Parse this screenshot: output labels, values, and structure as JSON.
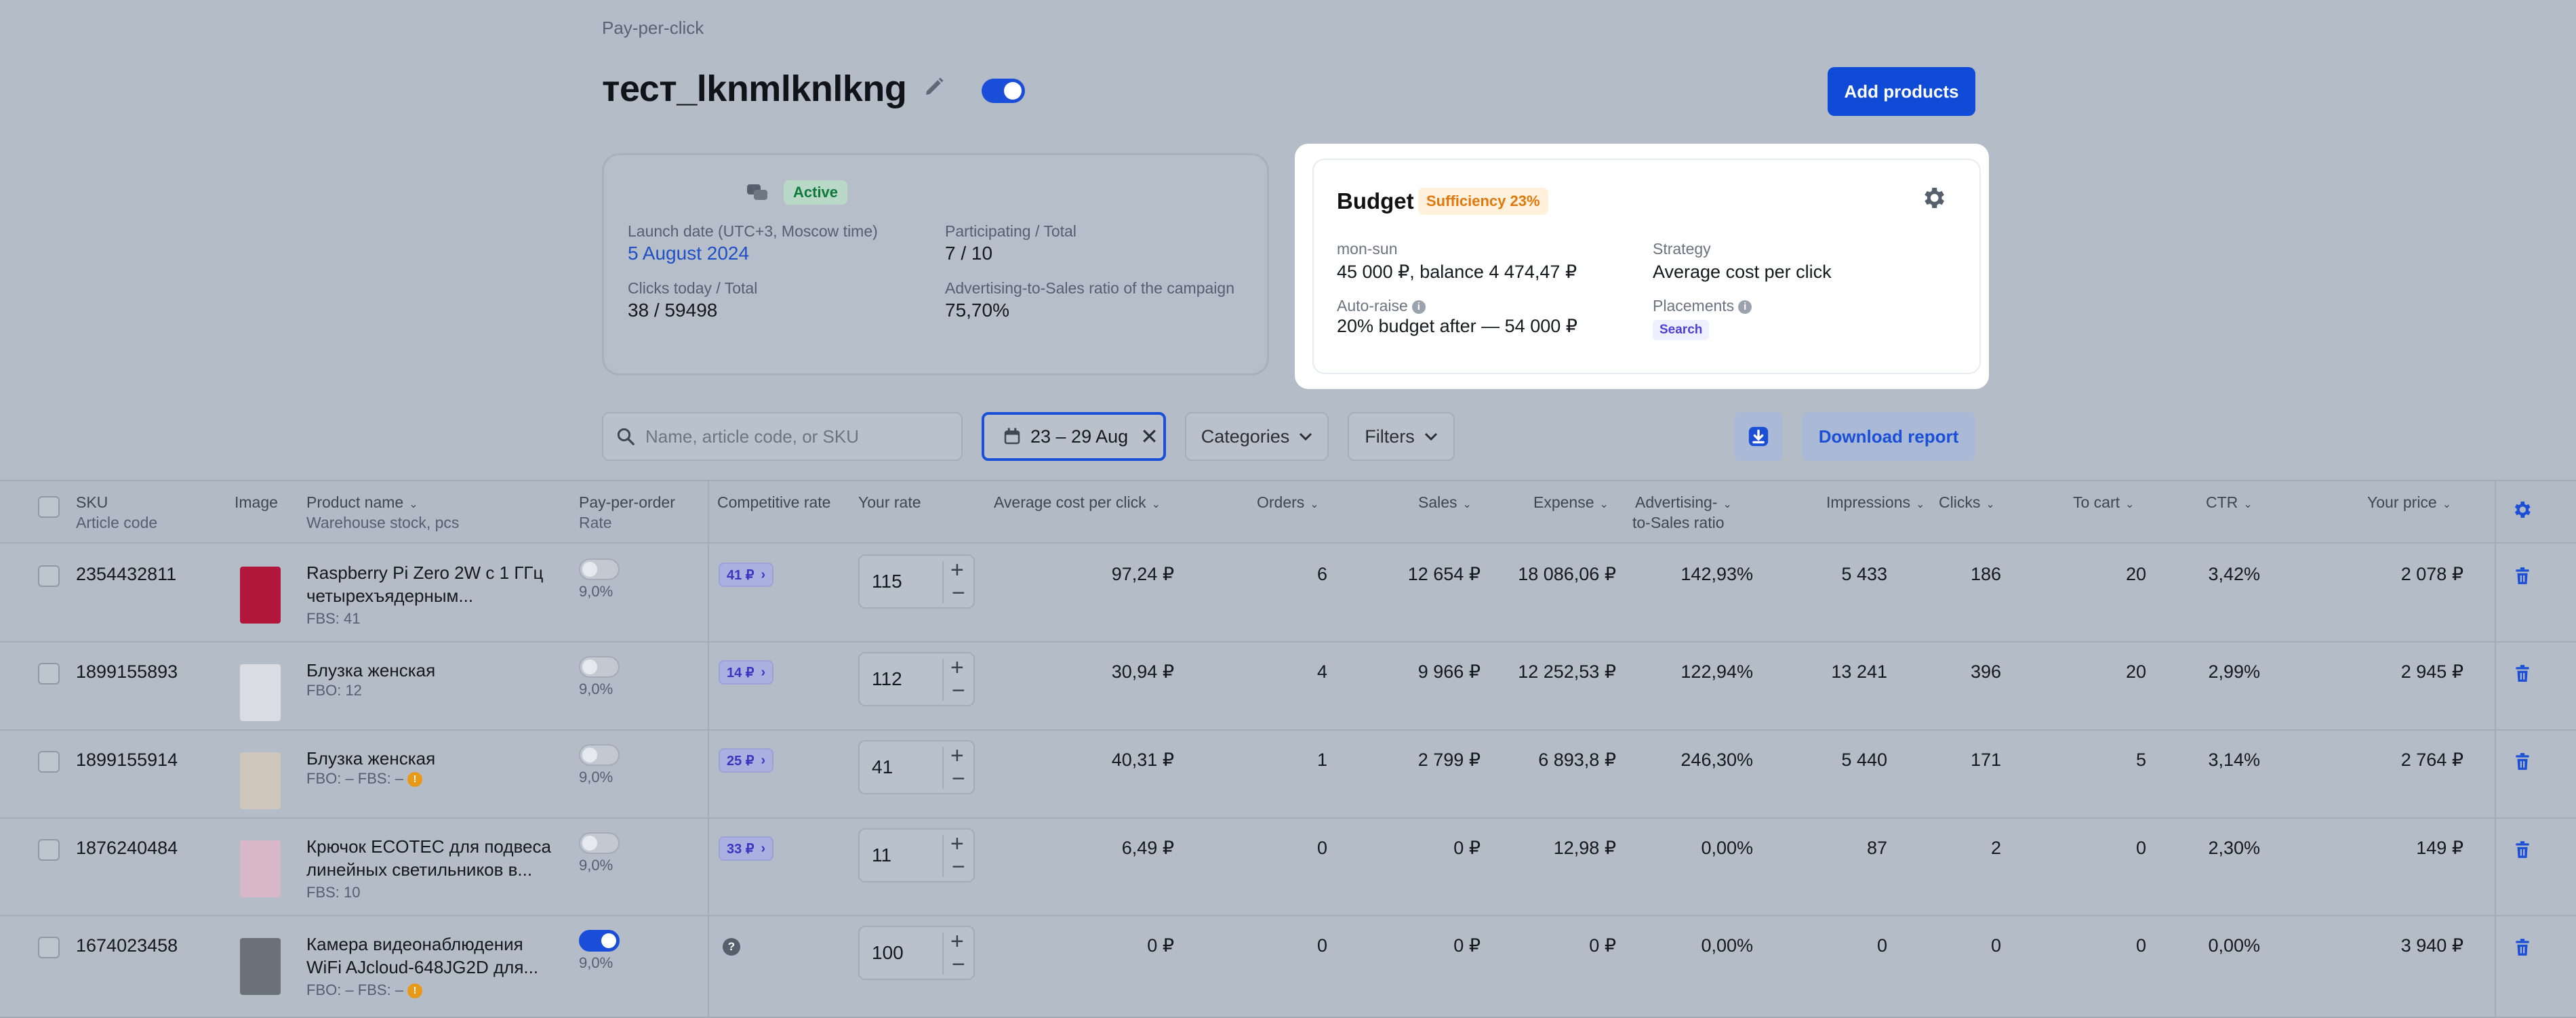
{
  "header": {
    "breadcrumb": "Pay-per-click",
    "title": "тест_lknmlknlkng",
    "add_products_label": "Add products",
    "campaign_enabled": true
  },
  "info_card": {
    "status": "Active",
    "launch_label": "Launch date (UTC+3, Moscow time)",
    "launch_value": "5 August 2024",
    "participating_label": "Participating / Total",
    "participating_value": "7 / 10",
    "clicks_label": "Clicks today / Total",
    "clicks_value": "38 / 59498",
    "ratio_label": "Advertising-to-Sales ratio of the campaign",
    "ratio_value": "75,70%"
  },
  "budget": {
    "title": "Budget",
    "sufficiency": "Sufficiency 23%",
    "period_label": "mon-sun",
    "period_value": "45 000 ₽, balance 4 474,47 ₽",
    "strategy_label": "Strategy",
    "strategy_value": "Average cost per click",
    "autoraise_label": "Auto-raise",
    "autoraise_value": "20% budget after — 54 000 ₽",
    "placements_label": "Placements",
    "placements_value": "Search"
  },
  "toolbar": {
    "search_placeholder": "Name, article code, or SKU",
    "date_range": "23 – 29 Aug",
    "categories_label": "Categories",
    "filters_label": "Filters",
    "download_report_label": "Download report"
  },
  "table": {
    "headers": {
      "sku": "SKU",
      "article": "Article code",
      "image": "Image",
      "product_name": "Product name",
      "warehouse": "Warehouse stock, pcs",
      "ppo": "Pay-per-order",
      "rate": "Rate",
      "competitive": "Competitive rate",
      "your_rate": "Your rate",
      "avg_cpc": "Average cost per click",
      "orders": "Orders",
      "sales": "Sales",
      "expense": "Expense",
      "ats1": "Advertising-",
      "ats2": "to-Sales ratio",
      "impressions": "Impressions",
      "clicks": "Clicks",
      "to_cart": "To cart",
      "ctr": "CTR",
      "your_price": "Your price"
    },
    "rows": [
      {
        "sku": "2354432811",
        "name1": "Raspberry Pi Zero 2W с 1 ГГц",
        "name2": "четырехъядерным...",
        "stock": "FBS: 41",
        "stock_warn": false,
        "ppo_on": false,
        "rate": "9,0%",
        "competitive": "41 ₽",
        "your_rate": "115",
        "avg_cpc": "97,24 ₽",
        "orders": "6",
        "sales": "12 654 ₽",
        "expense": "18 086,06 ₽",
        "ats": "142,93%",
        "impressions": "5 433",
        "clicks": "186",
        "to_cart": "20",
        "ctr": "3,42%",
        "price": "2 078 ₽",
        "thumb": "#b0173a"
      },
      {
        "sku": "1899155893",
        "name1": "Блузка женская",
        "name2": "",
        "stock": "FBO: 12",
        "stock_warn": false,
        "ppo_on": false,
        "rate": "9,0%",
        "competitive": "14 ₽",
        "your_rate": "112",
        "avg_cpc": "30,94 ₽",
        "orders": "4",
        "sales": "9 966 ₽",
        "expense": "12 252,53 ₽",
        "ats": "122,94%",
        "impressions": "13 241",
        "clicks": "396",
        "to_cart": "20",
        "ctr": "2,99%",
        "price": "2 945 ₽",
        "thumb": "#d9dde3"
      },
      {
        "sku": "1899155914",
        "name1": "Блузка женская",
        "name2": "",
        "stock": "FBO: –   FBS: –",
        "stock_warn": true,
        "ppo_on": false,
        "rate": "9,0%",
        "competitive": "25 ₽",
        "your_rate": "41",
        "avg_cpc": "40,31 ₽",
        "orders": "1",
        "sales": "2 799 ₽",
        "expense": "6 893,8 ₽",
        "ats": "246,30%",
        "impressions": "5 440",
        "clicks": "171",
        "to_cart": "5",
        "ctr": "3,14%",
        "price": "2 764 ₽",
        "thumb": "#cfc7bb"
      },
      {
        "sku": "1876240484",
        "name1": "Крючок ECOTEC для подвеса",
        "name2": "линейных светильников в...",
        "stock": "FBS: 10",
        "stock_warn": false,
        "ppo_on": false,
        "rate": "9,0%",
        "competitive": "33 ₽",
        "your_rate": "11",
        "avg_cpc": "6,49 ₽",
        "orders": "0",
        "sales": "0 ₽",
        "expense": "12,98 ₽",
        "ats": "0,00%",
        "impressions": "87",
        "clicks": "2",
        "to_cart": "0",
        "ctr": "2,30%",
        "price": "149 ₽",
        "thumb": "#d8b8c6"
      },
      {
        "sku": "1674023458",
        "name1": "Камера видеонаблюдения",
        "name2": "WiFi AJcloud-648JG2D для...",
        "stock": "FBO: –   FBS: –",
        "stock_warn": true,
        "ppo_on": true,
        "rate": "9,0%",
        "competitive": "",
        "your_rate": "100",
        "avg_cpc": "0 ₽",
        "orders": "0",
        "sales": "0 ₽",
        "expense": "0 ₽",
        "ats": "0,00%",
        "impressions": "0",
        "clicks": "0",
        "to_cart": "0",
        "ctr": "0,00%",
        "price": "3 940 ₽",
        "thumb": "#6b7178"
      }
    ]
  }
}
